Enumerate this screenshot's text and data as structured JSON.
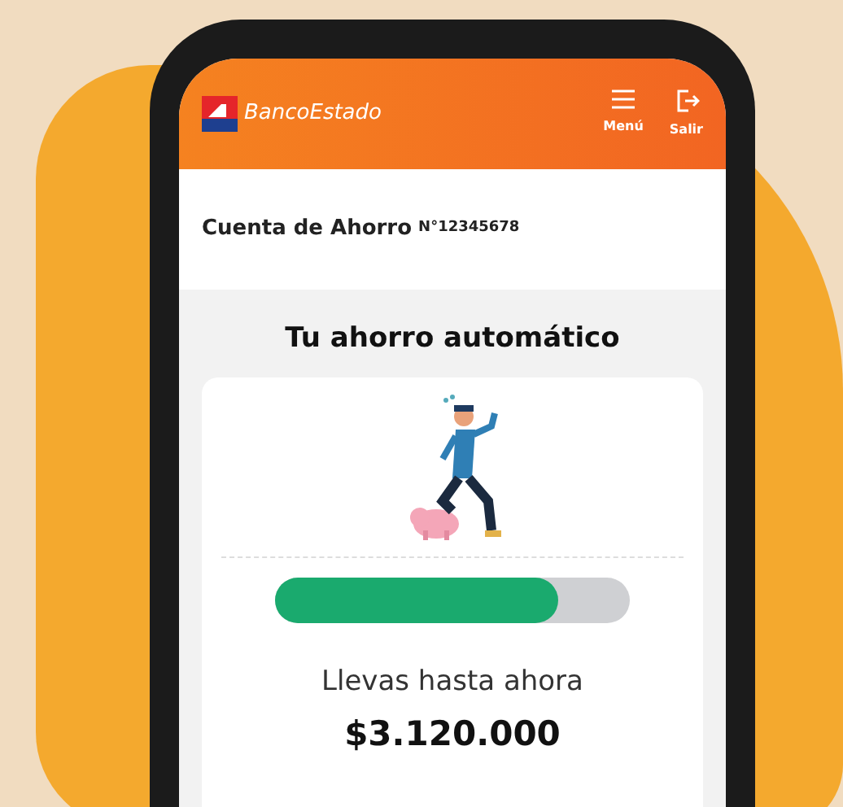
{
  "header": {
    "brand": "BancoEstado",
    "actions": [
      {
        "kind": "menu",
        "label": "Menú"
      },
      {
        "kind": "exit",
        "label": "Salir"
      }
    ]
  },
  "account": {
    "label": "Cuenta de Ahorro",
    "number": "N°12345678"
  },
  "savings": {
    "title": "Tu ahorro automático",
    "progress": {
      "level": 0.8
    },
    "caption": "Llevas hasta ahora",
    "amount": "$3.120.000"
  }
}
